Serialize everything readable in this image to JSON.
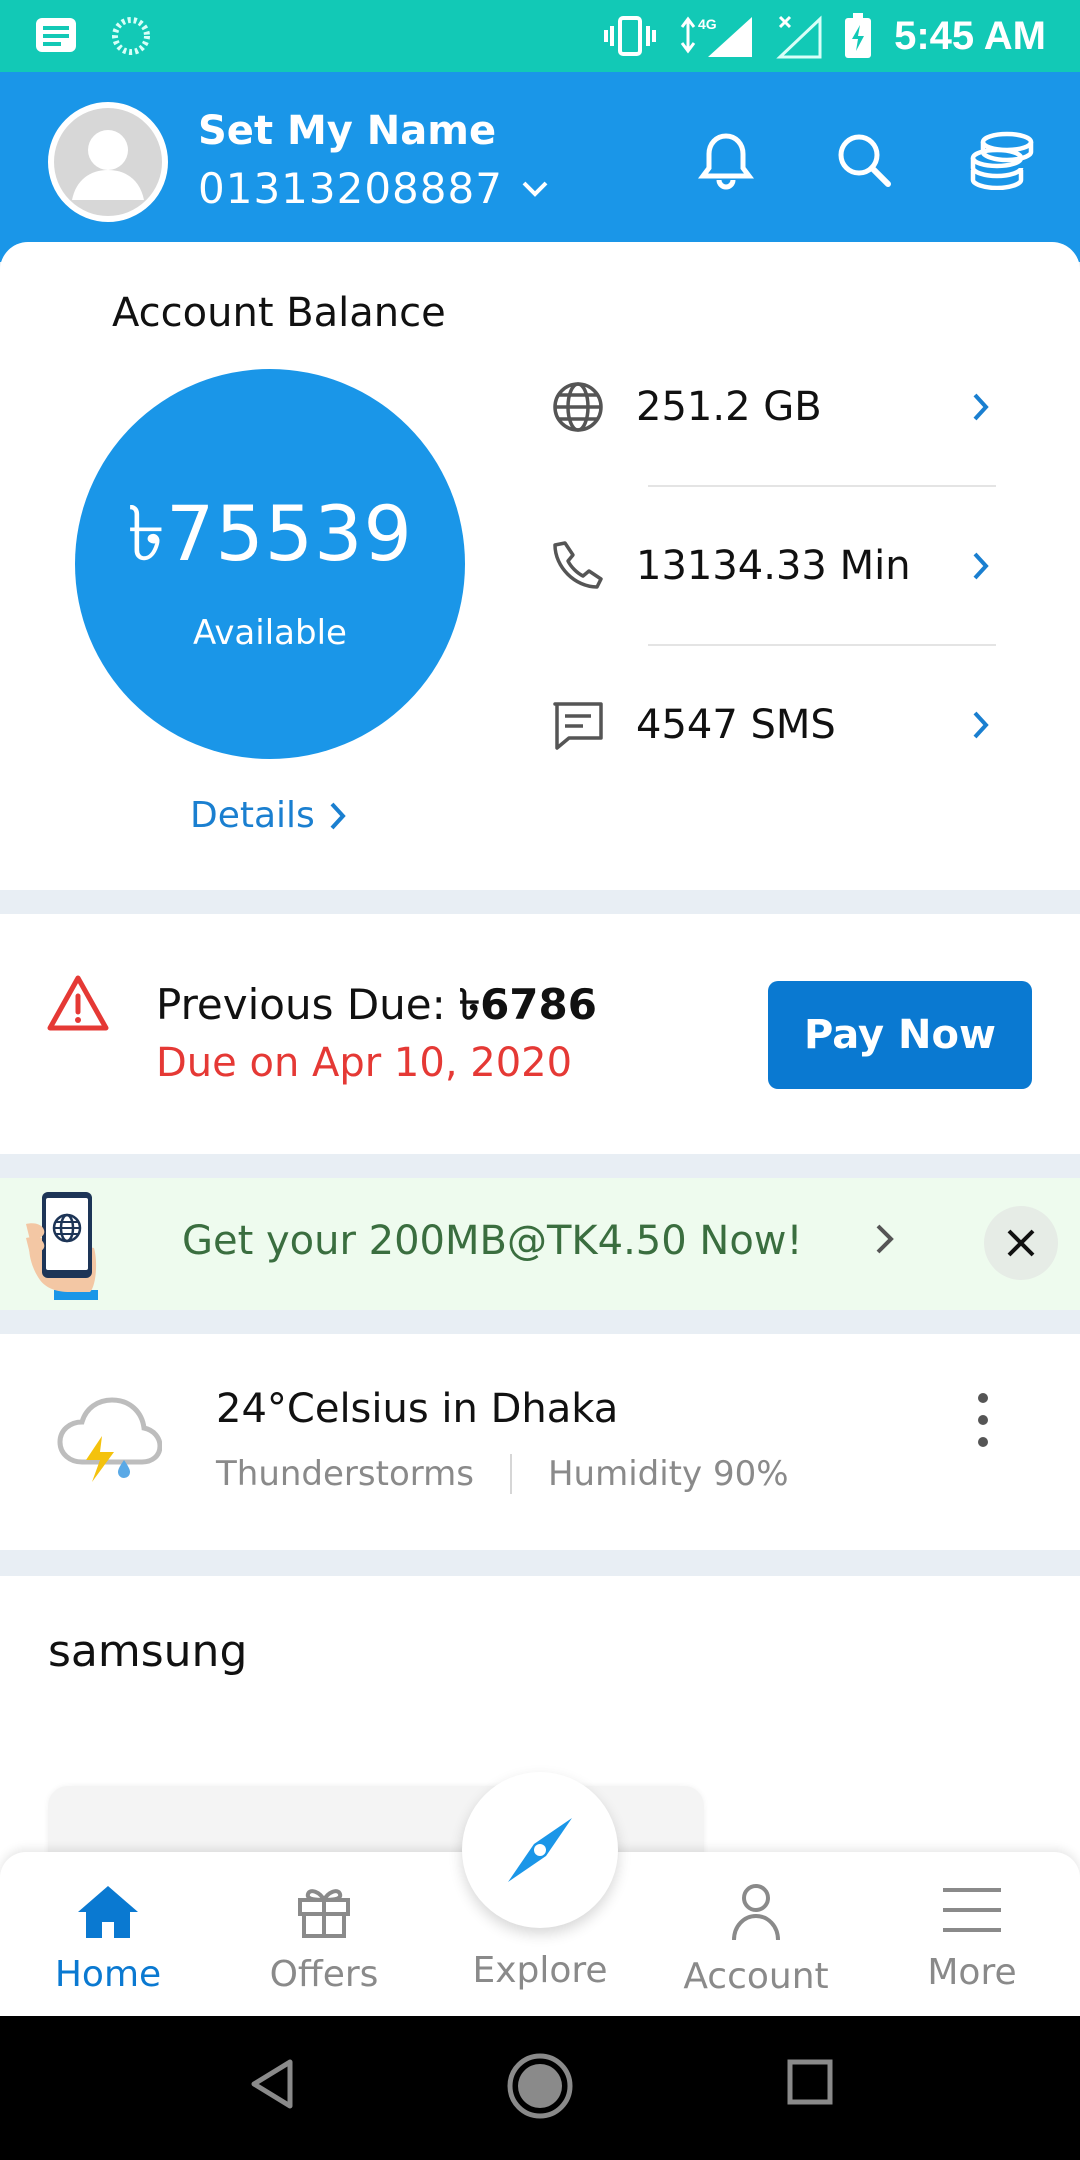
{
  "status_bar": {
    "time": "5:45 AM",
    "network": "4G"
  },
  "header": {
    "user_name": "Set My Name",
    "phone": "01313208887"
  },
  "balance": {
    "title": "Account Balance",
    "amount": "৳75539",
    "label": "Available",
    "details": "Details",
    "usage": [
      {
        "value": "251.2  GB",
        "icon": "globe-icon"
      },
      {
        "value": "13134.33  Min",
        "icon": "phone-icon"
      },
      {
        "value": "4547  SMS",
        "icon": "sms-icon"
      }
    ]
  },
  "due": {
    "label": "Previous Due: ",
    "amount": "৳6786",
    "date": "Due on Apr 10, 2020",
    "pay_button": "Pay Now"
  },
  "promo": {
    "text": "Get your 200MB@TK4.50 Now!"
  },
  "weather": {
    "title": "24°Celsius in Dhaka",
    "condition": "Thunderstorms",
    "humidity": "Humidity 90%"
  },
  "section": {
    "title": "samsung"
  },
  "nav": {
    "home": "Home",
    "offers": "Offers",
    "explore": "Explore",
    "account": "Account",
    "more": "More"
  },
  "colors": {
    "primary": "#1a96e8",
    "button": "#0a79d1",
    "status_bar": "#12c9b6",
    "alert": "#e53935"
  }
}
